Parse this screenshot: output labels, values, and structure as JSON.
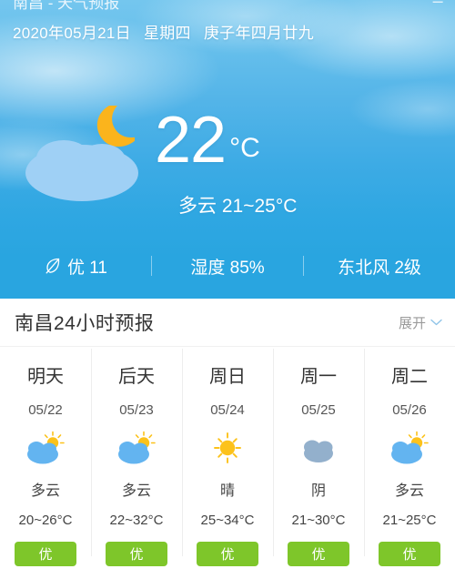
{
  "topbar": {
    "title": "南昌 - 天气预报",
    "right_icon": "menu-icon"
  },
  "hero": {
    "date_text": "2020年05月21日",
    "weekday_text": "星期四",
    "lunar_text": "庚子年四月廿九",
    "icon": "cloudy-night-icon",
    "temperature": "22",
    "unit": "°C",
    "condition_range": "多云 21~25°C",
    "stats": [
      {
        "icon": "leaf-icon",
        "text": "优 11",
        "name": "air-quality"
      },
      {
        "icon": "",
        "text": "湿度 85%",
        "name": "humidity"
      },
      {
        "icon": "",
        "text": "东北风 2级",
        "name": "wind"
      }
    ]
  },
  "forecast": {
    "title": "南昌24小时预报",
    "expand_label": "展开",
    "expand_icon": "chevron-down-icon",
    "days": [
      {
        "name": "明天",
        "date": "05/22",
        "icon": "cloudy-day-icon",
        "condition": "多云",
        "temp": "20~26°C",
        "badge": "优",
        "badge_color": "#7ec62a"
      },
      {
        "name": "后天",
        "date": "05/23",
        "icon": "cloudy-day-icon",
        "condition": "多云",
        "temp": "22~32°C",
        "badge": "优",
        "badge_color": "#7ec62a"
      },
      {
        "name": "周日",
        "date": "05/24",
        "icon": "sunny-icon",
        "condition": "晴",
        "temp": "25~34°C",
        "badge": "优",
        "badge_color": "#7ec62a"
      },
      {
        "name": "周一",
        "date": "05/25",
        "icon": "overcast-icon",
        "condition": "阴",
        "temp": "21~30°C",
        "badge": "优",
        "badge_color": "#7ec62a"
      },
      {
        "name": "周二",
        "date": "05/26",
        "icon": "cloudy-day-icon",
        "condition": "多云",
        "temp": "21~25°C",
        "badge": "优",
        "badge_color": "#7ec62a"
      }
    ]
  },
  "colors": {
    "sky_top": "#74c6ee",
    "sky_bottom": "#29a5e0",
    "cloud_blue": "#9fd0f5",
    "moon_orange": "#fbb41c",
    "sun_yellow": "#fcc21b",
    "overcast_gray": "#93b0cc",
    "badge_green": "#7ec62a"
  }
}
